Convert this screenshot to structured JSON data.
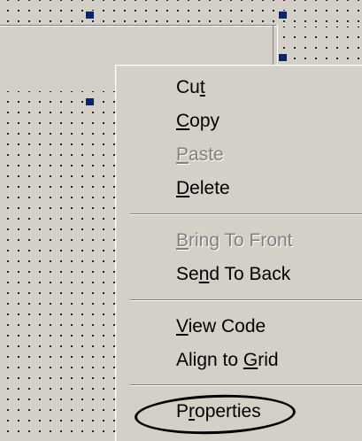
{
  "context_menu": {
    "items": [
      {
        "label": "Cut",
        "mnemonic_index": 2,
        "enabled": true
      },
      {
        "label": "Copy",
        "mnemonic_index": 0,
        "enabled": true
      },
      {
        "label": "Paste",
        "mnemonic_index": 0,
        "enabled": false
      },
      {
        "label": "Delete",
        "mnemonic_index": 0,
        "enabled": true
      },
      {
        "label": "Bring To Front",
        "mnemonic_index": 0,
        "enabled": false
      },
      {
        "label": "Send To Back",
        "mnemonic_index": 2,
        "enabled": true
      },
      {
        "label": "View Code",
        "mnemonic_index": 0,
        "enabled": true
      },
      {
        "label": "Align to Grid",
        "mnemonic_index": 9,
        "enabled": true
      },
      {
        "label": "Properties",
        "mnemonic_index": 1,
        "enabled": true
      }
    ],
    "highlighted_item": "Properties"
  },
  "colors": {
    "face": "#d4d0c8",
    "shadow": "#808080",
    "handle": "#0a246a",
    "grid_dot": "#000000"
  },
  "icons": [
    "selection-handle",
    "annotation-circle"
  ]
}
